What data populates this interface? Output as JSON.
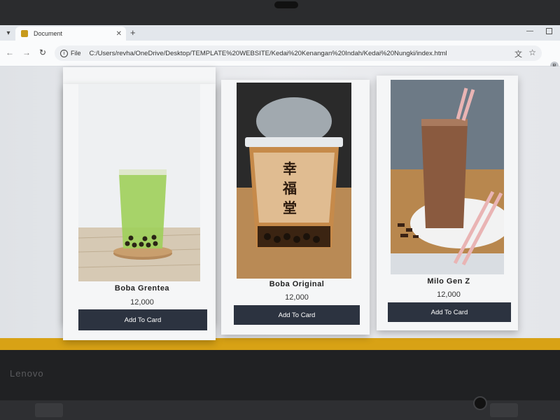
{
  "browser": {
    "tab_title": "Document",
    "site_info_label": "File",
    "url": "C:/Users/revha/OneDrive/Desktop/TEMPLATE%20WEBSITE/Kedai%20Kenangan%20Indah/Kedai%20Nungki/index.html",
    "avatar_letter": "R"
  },
  "device": {
    "brand": "Lenovo"
  },
  "products": [
    {
      "name": "Boba Grentea",
      "price": "12,000",
      "button_label": "Add To Card"
    },
    {
      "name": "Boba Original",
      "price": "12,000",
      "button_label": "Add To Card"
    },
    {
      "name": "Milo Gen Z",
      "price": "12,000",
      "button_label": "Add To Card"
    }
  ],
  "colors": {
    "button_bg": "#2c3340",
    "accent_strip": "#d8a215",
    "card_bg": "#f5f6f7"
  },
  "icons": [
    "tab-menu-icon",
    "close-icon",
    "plus-icon",
    "back-icon",
    "forward-icon",
    "reload-icon",
    "info-icon",
    "translate-icon",
    "star-icon"
  ]
}
